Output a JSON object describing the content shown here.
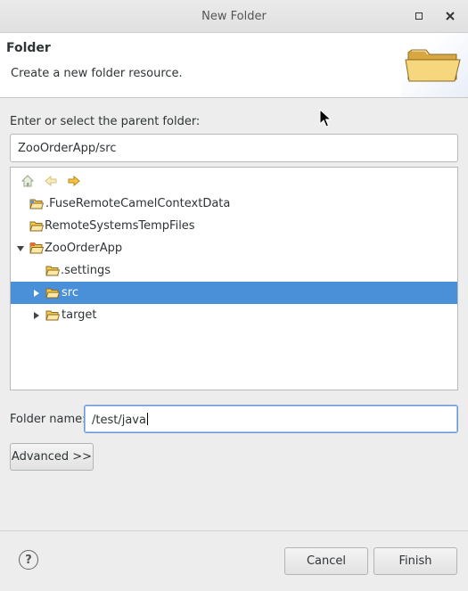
{
  "window": {
    "title": "New Folder"
  },
  "header": {
    "title": "Folder",
    "description": "Create a new folder resource."
  },
  "parent": {
    "label": "Enter or select the parent folder:",
    "value": "ZooOrderApp/src"
  },
  "tree": {
    "toolbar": [
      "home-icon",
      "back-arrow-icon",
      "forward-arrow-icon"
    ],
    "items": [
      {
        "label": ".FuseRemoteCamelContextData",
        "level": 0,
        "expandable": false,
        "icon": "open-folder-icon"
      },
      {
        "label": "RemoteSystemsTempFiles",
        "level": 0,
        "expandable": false,
        "icon": "open-folder-icon"
      },
      {
        "label": "ZooOrderApp",
        "level": 0,
        "expandable": true,
        "expanded": true,
        "icon": "project-icon"
      },
      {
        "label": ".settings",
        "level": 1,
        "expandable": false,
        "icon": "folder-icon"
      },
      {
        "label": "src",
        "level": 1,
        "expandable": true,
        "expanded": false,
        "selected": true,
        "icon": "folder-icon"
      },
      {
        "label": "target",
        "level": 1,
        "expandable": true,
        "expanded": false,
        "icon": "folder-icon"
      }
    ]
  },
  "folder_name": {
    "label": "Folder name:",
    "value": "/test/java"
  },
  "buttons": {
    "advanced": "Advanced >>",
    "cancel": "Cancel",
    "finish": "Finish",
    "help": "?"
  },
  "colors": {
    "selection": "#4a90d9",
    "folder": "#f2c94c"
  }
}
